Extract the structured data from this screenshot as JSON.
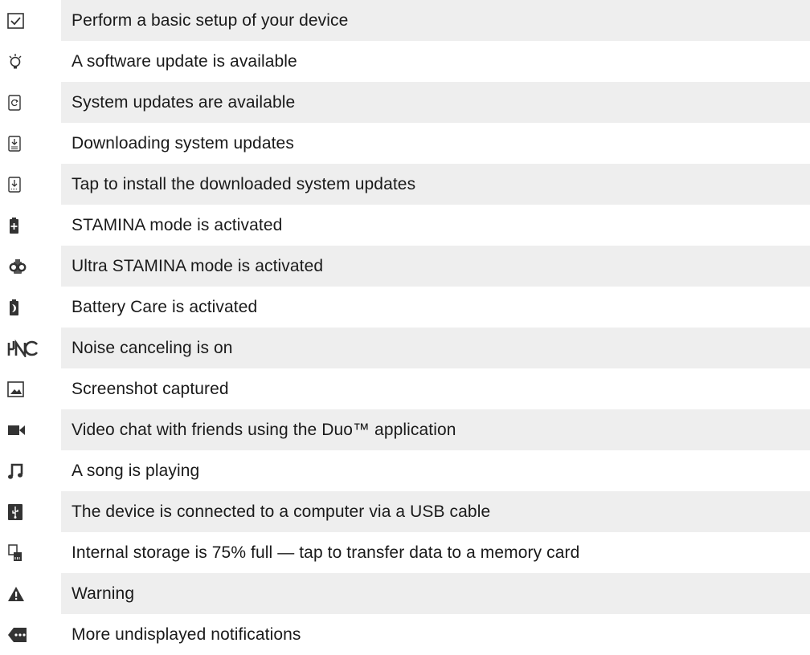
{
  "rows": [
    {
      "icon": "checkbox-checked-icon",
      "label": "Perform a basic setup of your device"
    },
    {
      "icon": "lightbulb-icon",
      "label": "A software update is available"
    },
    {
      "icon": "system-update-icon",
      "label": "System updates are available"
    },
    {
      "icon": "downloading-icon",
      "label": "Downloading system updates"
    },
    {
      "icon": "install-download-icon",
      "label": "Tap to install the downloaded system updates"
    },
    {
      "icon": "stamina-battery-icon",
      "label": "STAMINA mode is activated"
    },
    {
      "icon": "ultra-stamina-icon",
      "label": "Ultra STAMINA mode is activated"
    },
    {
      "icon": "battery-care-icon",
      "label": "Battery Care is activated"
    },
    {
      "icon": "noise-canceling-icon",
      "label": "Noise canceling is on"
    },
    {
      "icon": "screenshot-icon",
      "label": "Screenshot captured"
    },
    {
      "icon": "video-camera-icon",
      "label": "Video chat with friends using the Duo™ application"
    },
    {
      "icon": "music-note-icon",
      "label": "A song is playing"
    },
    {
      "icon": "usb-icon",
      "label": "The device is connected to a computer via a USB cable"
    },
    {
      "icon": "storage-card-icon",
      "label": "Internal storage is 75% full — tap to transfer data to a memory card"
    },
    {
      "icon": "warning-icon",
      "label": "Warning"
    },
    {
      "icon": "more-notifications-icon",
      "label": "More undisplayed notifications"
    }
  ],
  "colors": {
    "row_shade": "#eeeeee",
    "text": "#1a1a1a",
    "icon": "#333333"
  }
}
